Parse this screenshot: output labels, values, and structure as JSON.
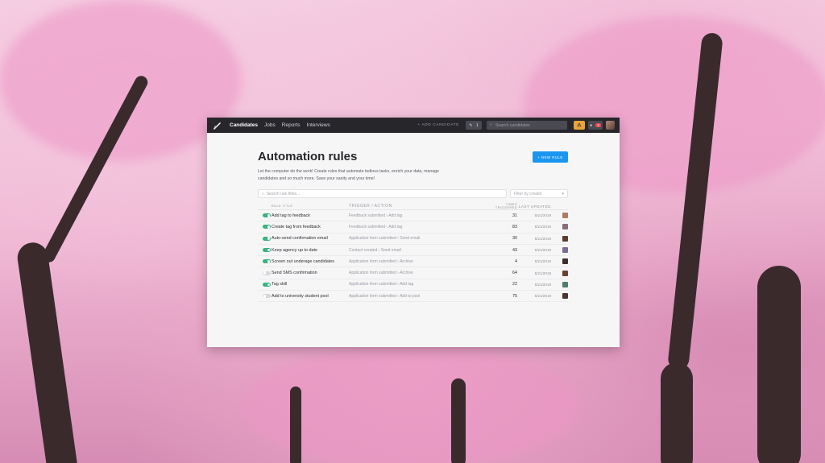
{
  "colors": {
    "accent": "#1b96f0",
    "toggle_on": "#36b37e",
    "navbar": "#26262b",
    "warning": "#e9a33a"
  },
  "nav": {
    "links": [
      "Candidates",
      "Jobs",
      "Reports",
      "Interviews"
    ],
    "add_candidate": "+ ADD CANDIDATE",
    "pen_count": "1",
    "search_placeholder": "Search candidates",
    "warning_icon": "warning-icon",
    "notifications": "2"
  },
  "page": {
    "title": "Automation rules",
    "new_button": "+ NEW RULE",
    "description": "Let the computer do the work! Create rules that automate tedious tasks, enrich your data, manage candidates and so much more. Save your sanity and your time!",
    "search_placeholder": "Search rule titles...",
    "filter_placeholder": "Filter by creator"
  },
  "table": {
    "headers": {
      "title": "RULE TITLE",
      "trigger": "TRIGGER / ACTION",
      "times": "TIMES TRIGGERED",
      "updated": "LAST UPDATED"
    },
    "rows": [
      {
        "enabled": true,
        "title": "Add tag to feedback",
        "trigger": "Feedback submitted › Add tag",
        "times": "31",
        "date": "5/21/2019",
        "avatar": "#b07a62"
      },
      {
        "enabled": true,
        "title": "Create tag from feedback",
        "trigger": "Feedback submitted › Add tag",
        "times": "83",
        "date": "5/21/2019",
        "avatar": "#8a6c7a"
      },
      {
        "enabled": true,
        "title": "Auto-send confirmation email",
        "trigger": "Application form submitted › Send email",
        "times": "30",
        "date": "5/21/2019",
        "avatar": "#5b3b32"
      },
      {
        "enabled": true,
        "title": "Keep agency up to date",
        "trigger": "Contact created › Send email",
        "times": "43",
        "date": "5/21/2019",
        "avatar": "#7b6a93"
      },
      {
        "enabled": true,
        "title": "Screen out underage candidates",
        "trigger": "Application form submitted › Archive",
        "times": "4",
        "date": "5/21/2019",
        "avatar": "#3f2f2a"
      },
      {
        "enabled": false,
        "title": "Send SMS confirmation",
        "trigger": "Application form submitted › Archive",
        "times": "64",
        "date": "5/21/2019",
        "avatar": "#6a4034"
      },
      {
        "enabled": true,
        "title": "Tag skill",
        "trigger": "Application form submitted › Add tag",
        "times": "22",
        "date": "5/21/2019",
        "avatar": "#4e7d6a"
      },
      {
        "enabled": false,
        "title": "Add to university student pool",
        "trigger": "Application form submitted › Add to pool",
        "times": "75",
        "date": "5/21/2019",
        "avatar": "#4a3530"
      }
    ]
  }
}
